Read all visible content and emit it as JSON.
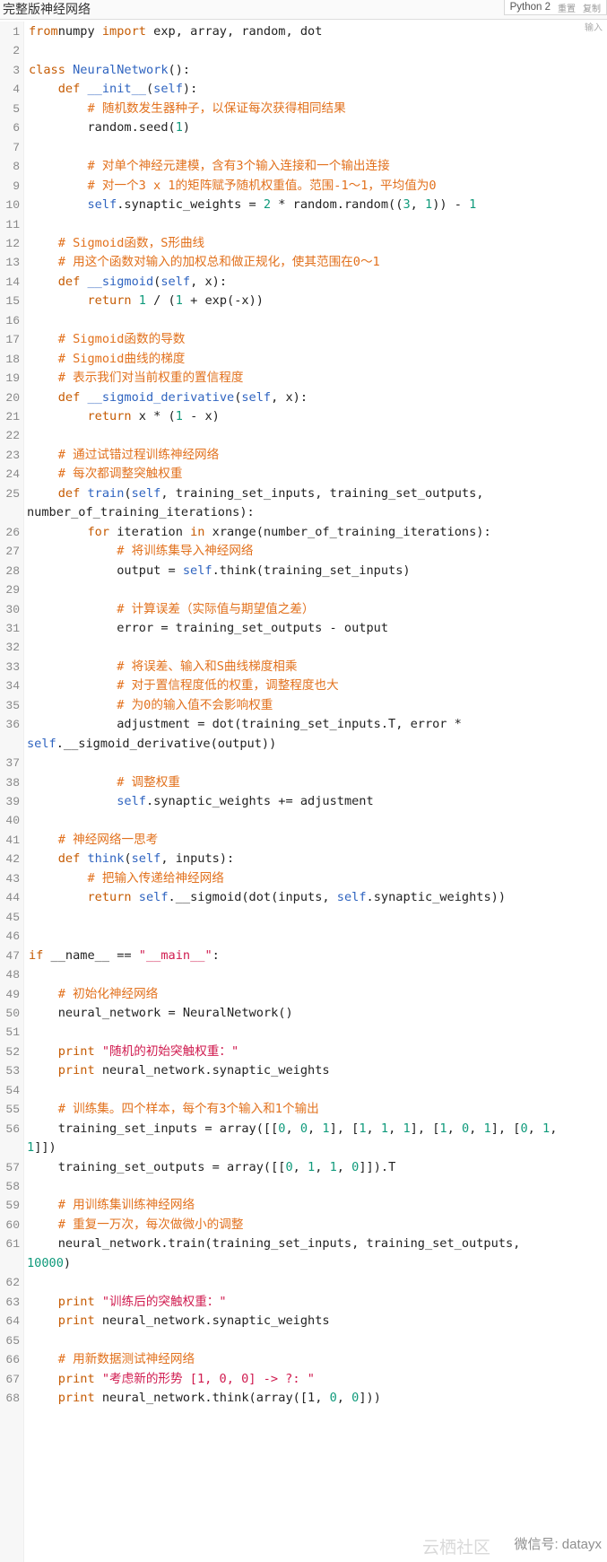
{
  "header": {
    "title": "完整版神经网络",
    "language": "Python 2",
    "reset_label": "重置",
    "copy_label": "复制",
    "input_label": "输入"
  },
  "code_lines": [
    {
      "n": "1",
      "tokens": [
        [
          "kw",
          "from"
        ],
        [
          "",
          "numpy "
        ],
        [
          "kw",
          "import"
        ],
        [
          "",
          " exp, array, random, dot"
        ]
      ]
    },
    {
      "n": "2",
      "tokens": []
    },
    {
      "n": "3",
      "tokens": [
        [
          "kw",
          "class"
        ],
        [
          "",
          " "
        ],
        [
          "fn",
          "NeuralNetwork"
        ],
        [
          "",
          "():"
        ]
      ]
    },
    {
      "n": "4",
      "tokens": [
        [
          "",
          "    "
        ],
        [
          "kw",
          "def"
        ],
        [
          "",
          " "
        ],
        [
          "fn",
          "__init__"
        ],
        [
          "",
          "("
        ],
        [
          "self",
          "self"
        ],
        [
          "",
          "):"
        ]
      ]
    },
    {
      "n": "5",
      "tokens": [
        [
          "",
          "        "
        ],
        [
          "cm",
          "# 随机数发生器种子，以保证每次获得相同结果"
        ]
      ]
    },
    {
      "n": "6",
      "tokens": [
        [
          "",
          "        random.seed("
        ],
        [
          "num",
          "1"
        ],
        [
          "",
          ")"
        ]
      ]
    },
    {
      "n": "7",
      "tokens": []
    },
    {
      "n": "8",
      "tokens": [
        [
          "",
          "        "
        ],
        [
          "cm",
          "# 对单个神经元建模，含有3个输入连接和一个输出连接"
        ]
      ]
    },
    {
      "n": "9",
      "tokens": [
        [
          "",
          "        "
        ],
        [
          "cm",
          "# 对一个3 x 1的矩阵赋予随机权重值。范围-1～1，平均值为0"
        ]
      ]
    },
    {
      "n": "10",
      "tokens": [
        [
          "",
          "        "
        ],
        [
          "self",
          "self"
        ],
        [
          "",
          ".synaptic_weights = "
        ],
        [
          "num",
          "2"
        ],
        [
          "",
          " * random.random(("
        ],
        [
          "num",
          "3"
        ],
        [
          "",
          ", "
        ],
        [
          "num",
          "1"
        ],
        [
          "",
          ")) - "
        ],
        [
          "num",
          "1"
        ]
      ]
    },
    {
      "n": "11",
      "tokens": []
    },
    {
      "n": "12",
      "tokens": [
        [
          "",
          "    "
        ],
        [
          "cm",
          "# Sigmoid函数，S形曲线"
        ]
      ]
    },
    {
      "n": "13",
      "tokens": [
        [
          "",
          "    "
        ],
        [
          "cm",
          "# 用这个函数对输入的加权总和做正规化，使其范围在0～1"
        ]
      ]
    },
    {
      "n": "14",
      "tokens": [
        [
          "",
          "    "
        ],
        [
          "kw",
          "def"
        ],
        [
          "",
          " "
        ],
        [
          "fn",
          "__sigmoid"
        ],
        [
          "",
          "("
        ],
        [
          "self",
          "self"
        ],
        [
          "",
          ", x):"
        ]
      ]
    },
    {
      "n": "15",
      "tokens": [
        [
          "",
          "        "
        ],
        [
          "kw",
          "return"
        ],
        [
          "",
          " "
        ],
        [
          "num",
          "1"
        ],
        [
          "",
          " / ("
        ],
        [
          "num",
          "1"
        ],
        [
          "",
          " + exp(-x))"
        ]
      ]
    },
    {
      "n": "16",
      "tokens": []
    },
    {
      "n": "17",
      "tokens": [
        [
          "",
          "    "
        ],
        [
          "cm",
          "# Sigmoid函数的导数"
        ]
      ]
    },
    {
      "n": "18",
      "tokens": [
        [
          "",
          "    "
        ],
        [
          "cm",
          "# Sigmoid曲线的梯度"
        ]
      ]
    },
    {
      "n": "19",
      "tokens": [
        [
          "",
          "    "
        ],
        [
          "cm",
          "# 表示我们对当前权重的置信程度"
        ]
      ]
    },
    {
      "n": "20",
      "tokens": [
        [
          "",
          "    "
        ],
        [
          "kw",
          "def"
        ],
        [
          "",
          " "
        ],
        [
          "fn",
          "__sigmoid_derivative"
        ],
        [
          "",
          "("
        ],
        [
          "self",
          "self"
        ],
        [
          "",
          ", x):"
        ]
      ]
    },
    {
      "n": "21",
      "tokens": [
        [
          "",
          "        "
        ],
        [
          "kw",
          "return"
        ],
        [
          "",
          " x * ("
        ],
        [
          "num",
          "1"
        ],
        [
          "",
          " - x)"
        ]
      ]
    },
    {
      "n": "22",
      "tokens": []
    },
    {
      "n": "23",
      "tokens": [
        [
          "",
          "    "
        ],
        [
          "cm",
          "# 通过试错过程训练神经网络"
        ]
      ]
    },
    {
      "n": "24",
      "tokens": [
        [
          "",
          "    "
        ],
        [
          "cm",
          "# 每次都调整突触权重"
        ]
      ]
    },
    {
      "n": "25",
      "tokens": [
        [
          "",
          "    "
        ],
        [
          "kw",
          "def"
        ],
        [
          "",
          " "
        ],
        [
          "fn",
          "train"
        ],
        [
          "",
          "("
        ],
        [
          "self",
          "self"
        ],
        [
          "",
          ", training_set_inputs, training_set_outputs,"
        ]
      ]
    },
    {
      "n": "",
      "tokens": [
        [
          "",
          "number_of_training_iterations):"
        ]
      ],
      "wrap": true
    },
    {
      "n": "26",
      "tokens": [
        [
          "",
          "        "
        ],
        [
          "kw",
          "for"
        ],
        [
          "",
          " iteration "
        ],
        [
          "kw",
          "in"
        ],
        [
          "",
          " xrange(number_of_training_iterations):"
        ]
      ]
    },
    {
      "n": "27",
      "tokens": [
        [
          "",
          "            "
        ],
        [
          "cm",
          "# 将训练集导入神经网络"
        ]
      ]
    },
    {
      "n": "28",
      "tokens": [
        [
          "",
          "            output = "
        ],
        [
          "self",
          "self"
        ],
        [
          "",
          ".think(training_set_inputs)"
        ]
      ]
    },
    {
      "n": "29",
      "tokens": []
    },
    {
      "n": "30",
      "tokens": [
        [
          "",
          "            "
        ],
        [
          "cm",
          "# 计算误差（实际值与期望值之差）"
        ]
      ]
    },
    {
      "n": "31",
      "tokens": [
        [
          "",
          "            error = training_set_outputs - output"
        ]
      ]
    },
    {
      "n": "32",
      "tokens": []
    },
    {
      "n": "33",
      "tokens": [
        [
          "",
          "            "
        ],
        [
          "cm",
          "# 将误差、输入和S曲线梯度相乘"
        ]
      ]
    },
    {
      "n": "34",
      "tokens": [
        [
          "",
          "            "
        ],
        [
          "cm",
          "# 对于置信程度低的权重，调整程度也大"
        ]
      ]
    },
    {
      "n": "35",
      "tokens": [
        [
          "",
          "            "
        ],
        [
          "cm",
          "# 为0的输入值不会影响权重"
        ]
      ]
    },
    {
      "n": "36",
      "tokens": [
        [
          "",
          "            adjustment = dot(training_set_inputs.T, error *"
        ]
      ]
    },
    {
      "n": "",
      "tokens": [
        [
          "self",
          "self"
        ],
        [
          "",
          ".__sigmoid_derivative(output))"
        ]
      ],
      "wrap": true
    },
    {
      "n": "37",
      "tokens": []
    },
    {
      "n": "38",
      "tokens": [
        [
          "",
          "            "
        ],
        [
          "cm",
          "# 调整权重"
        ]
      ]
    },
    {
      "n": "39",
      "tokens": [
        [
          "",
          "            "
        ],
        [
          "self",
          "self"
        ],
        [
          "",
          ".synaptic_weights += adjustment"
        ]
      ]
    },
    {
      "n": "40",
      "tokens": []
    },
    {
      "n": "41",
      "tokens": [
        [
          "",
          "    "
        ],
        [
          "cm",
          "# 神经网络一思考"
        ]
      ]
    },
    {
      "n": "42",
      "tokens": [
        [
          "",
          "    "
        ],
        [
          "kw",
          "def"
        ],
        [
          "",
          " "
        ],
        [
          "fn",
          "think"
        ],
        [
          "",
          "("
        ],
        [
          "self",
          "self"
        ],
        [
          "",
          ", inputs):"
        ]
      ]
    },
    {
      "n": "43",
      "tokens": [
        [
          "",
          "        "
        ],
        [
          "cm",
          "# 把输入传递给神经网络"
        ]
      ]
    },
    {
      "n": "44",
      "tokens": [
        [
          "",
          "        "
        ],
        [
          "kw",
          "return"
        ],
        [
          "",
          " "
        ],
        [
          "self",
          "self"
        ],
        [
          "",
          ".__sigmoid(dot(inputs, "
        ],
        [
          "self",
          "self"
        ],
        [
          "",
          ".synaptic_weights))"
        ]
      ]
    },
    {
      "n": "45",
      "tokens": []
    },
    {
      "n": "46",
      "tokens": []
    },
    {
      "n": "47",
      "tokens": [
        [
          "kw",
          "if"
        ],
        [
          "",
          " __name__ == "
        ],
        [
          "str",
          "\"__main__\""
        ],
        [
          "",
          ":"
        ]
      ]
    },
    {
      "n": "48",
      "tokens": []
    },
    {
      "n": "49",
      "tokens": [
        [
          "",
          "    "
        ],
        [
          "cm",
          "# 初始化神经网络"
        ]
      ]
    },
    {
      "n": "50",
      "tokens": [
        [
          "",
          "    neural_network = NeuralNetwork()"
        ]
      ]
    },
    {
      "n": "51",
      "tokens": []
    },
    {
      "n": "52",
      "tokens": [
        [
          "",
          "    "
        ],
        [
          "kw",
          "print"
        ],
        [
          "",
          " "
        ],
        [
          "str",
          "\"随机的初始突触权重：\""
        ]
      ]
    },
    {
      "n": "53",
      "tokens": [
        [
          "",
          "    "
        ],
        [
          "kw",
          "print"
        ],
        [
          "",
          " neural_network.synaptic_weights"
        ]
      ]
    },
    {
      "n": "54",
      "tokens": []
    },
    {
      "n": "55",
      "tokens": [
        [
          "",
          "    "
        ],
        [
          "cm",
          "# 训练集。四个样本，每个有3个输入和1个输出"
        ]
      ]
    },
    {
      "n": "56",
      "tokens": [
        [
          "",
          "    training_set_inputs = array([["
        ],
        [
          "num",
          "0"
        ],
        [
          "",
          ", "
        ],
        [
          "num",
          "0"
        ],
        [
          "",
          ", "
        ],
        [
          "num",
          "1"
        ],
        [
          "",
          "], ["
        ],
        [
          "num",
          "1"
        ],
        [
          "",
          ", "
        ],
        [
          "num",
          "1"
        ],
        [
          "",
          ", "
        ],
        [
          "num",
          "1"
        ],
        [
          "",
          "], ["
        ],
        [
          "num",
          "1"
        ],
        [
          "",
          ", "
        ],
        [
          "num",
          "0"
        ],
        [
          "",
          ", "
        ],
        [
          "num",
          "1"
        ],
        [
          "",
          "], ["
        ],
        [
          "num",
          "0"
        ],
        [
          "",
          ", "
        ],
        [
          "num",
          "1"
        ],
        [
          "",
          ","
        ]
      ]
    },
    {
      "n": "",
      "tokens": [
        [
          "num",
          "1"
        ],
        [
          "",
          "]])"
        ]
      ],
      "wrap": true
    },
    {
      "n": "57",
      "tokens": [
        [
          "",
          "    training_set_outputs = array([["
        ],
        [
          "num",
          "0"
        ],
        [
          "",
          ", "
        ],
        [
          "num",
          "1"
        ],
        [
          "",
          ", "
        ],
        [
          "num",
          "1"
        ],
        [
          "",
          ", "
        ],
        [
          "num",
          "0"
        ],
        [
          "",
          "]]).T"
        ]
      ]
    },
    {
      "n": "58",
      "tokens": []
    },
    {
      "n": "59",
      "tokens": [
        [
          "",
          "    "
        ],
        [
          "cm",
          "# 用训练集训练神经网络"
        ]
      ]
    },
    {
      "n": "60",
      "tokens": [
        [
          "",
          "    "
        ],
        [
          "cm",
          "# 重复一万次，每次做微小的调整"
        ]
      ]
    },
    {
      "n": "61",
      "tokens": [
        [
          "",
          "    neural_network.train(training_set_inputs, training_set_outputs,"
        ]
      ]
    },
    {
      "n": "",
      "tokens": [
        [
          "num",
          "10000"
        ],
        [
          "",
          ")"
        ]
      ],
      "wrap": true
    },
    {
      "n": "62",
      "tokens": []
    },
    {
      "n": "63",
      "tokens": [
        [
          "",
          "    "
        ],
        [
          "kw",
          "print"
        ],
        [
          "",
          " "
        ],
        [
          "str",
          "\"训练后的突触权重：\""
        ]
      ]
    },
    {
      "n": "64",
      "tokens": [
        [
          "",
          "    "
        ],
        [
          "kw",
          "print"
        ],
        [
          "",
          " neural_network.synaptic_weights"
        ]
      ]
    },
    {
      "n": "65",
      "tokens": []
    },
    {
      "n": "66",
      "tokens": [
        [
          "",
          "    "
        ],
        [
          "cm",
          "# 用新数据测试神经网络"
        ]
      ]
    },
    {
      "n": "67",
      "tokens": [
        [
          "",
          "    "
        ],
        [
          "kw",
          "print"
        ],
        [
          "",
          " "
        ],
        [
          "str",
          "\"考虑新的形势 [1, 0, 0] -> ?: \""
        ]
      ]
    },
    {
      "n": "68",
      "tokens": [
        [
          "",
          "    "
        ],
        [
          "kw",
          "print"
        ],
        [
          "",
          " neural_network.think(array([1, "
        ],
        [
          "num",
          "0"
        ],
        [
          "",
          ", "
        ],
        [
          "num",
          "0"
        ],
        [
          "",
          "]))"
        ]
      ]
    }
  ],
  "watermark": {
    "text": "微信号: datayx",
    "faint_text": "云栖社区"
  }
}
